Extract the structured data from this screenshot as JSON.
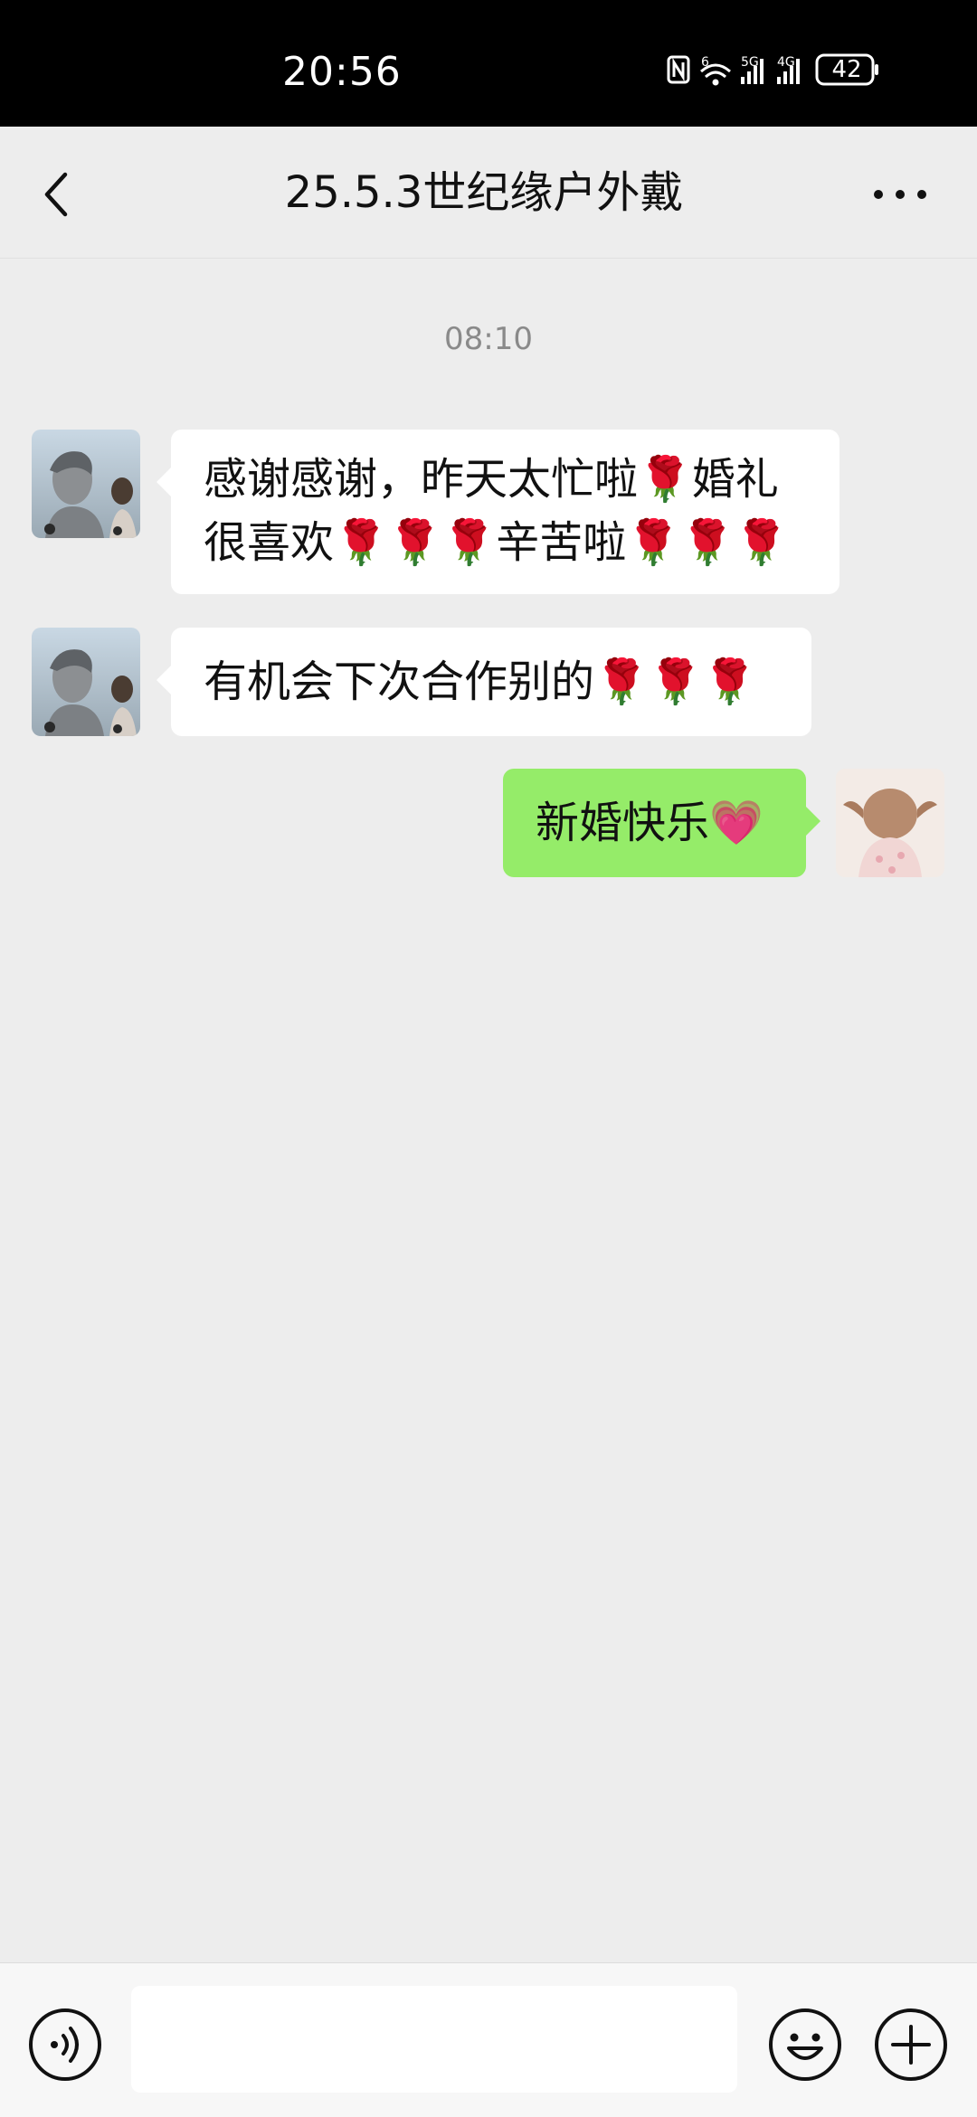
{
  "status_bar": {
    "time": "20:56",
    "battery": "42",
    "icons": [
      "nfc-icon",
      "wifi-icon",
      "5g-signal-icon",
      "4g-signal-icon",
      "battery-icon"
    ]
  },
  "header": {
    "title": "25.5.3世纪缘户外戴",
    "back_icon": "chevron-left-icon",
    "more_icon": "more-dots-icon"
  },
  "chat": {
    "timestamp": "08:10",
    "messages": [
      {
        "side": "left",
        "line1": "感谢感谢，昨天太忙啦🌹婚礼",
        "line2": "很喜欢🌹🌹🌹辛苦啦🌹🌹🌹"
      },
      {
        "side": "left",
        "text": "有机会下次合作别的🌹🌹🌹"
      },
      {
        "side": "right",
        "text": "新婚快乐💗"
      }
    ]
  },
  "input_bar": {
    "value": "",
    "voice_icon": "voice-icon",
    "emoji_icon": "emoji-icon",
    "plus_icon": "plus-icon"
  },
  "colors": {
    "background": "#ededed",
    "sent_bubble": "#95ec69",
    "received_bubble": "#ffffff"
  }
}
